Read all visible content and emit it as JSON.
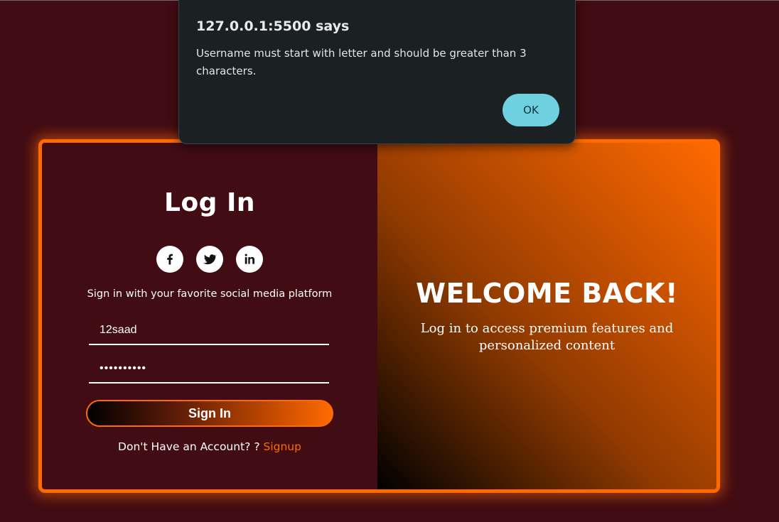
{
  "dialog": {
    "title": "127.0.0.1:5500 says",
    "message": "Username must start with letter and should be greater than 3 characters.",
    "ok_label": "OK",
    "ok_color": "#6fd0e0"
  },
  "login": {
    "title": "Log In",
    "social_icons": [
      "facebook-icon",
      "twitter-icon",
      "linkedin-icon"
    ],
    "social_text": "Sign in with your favorite social media platform",
    "username_value": "12saad",
    "password_value": "••••••••••",
    "signin_label": "Sign In",
    "signup_prompt": "Don't Have an Account? ?",
    "signup_link": "Signup"
  },
  "welcome": {
    "title": "WELCOME BACK!",
    "subtitle": "Log in to access premium features and personalized content"
  },
  "colors": {
    "background": "#410c13",
    "accent": "#ff6a00",
    "dialog_bg": "#1b2023"
  }
}
